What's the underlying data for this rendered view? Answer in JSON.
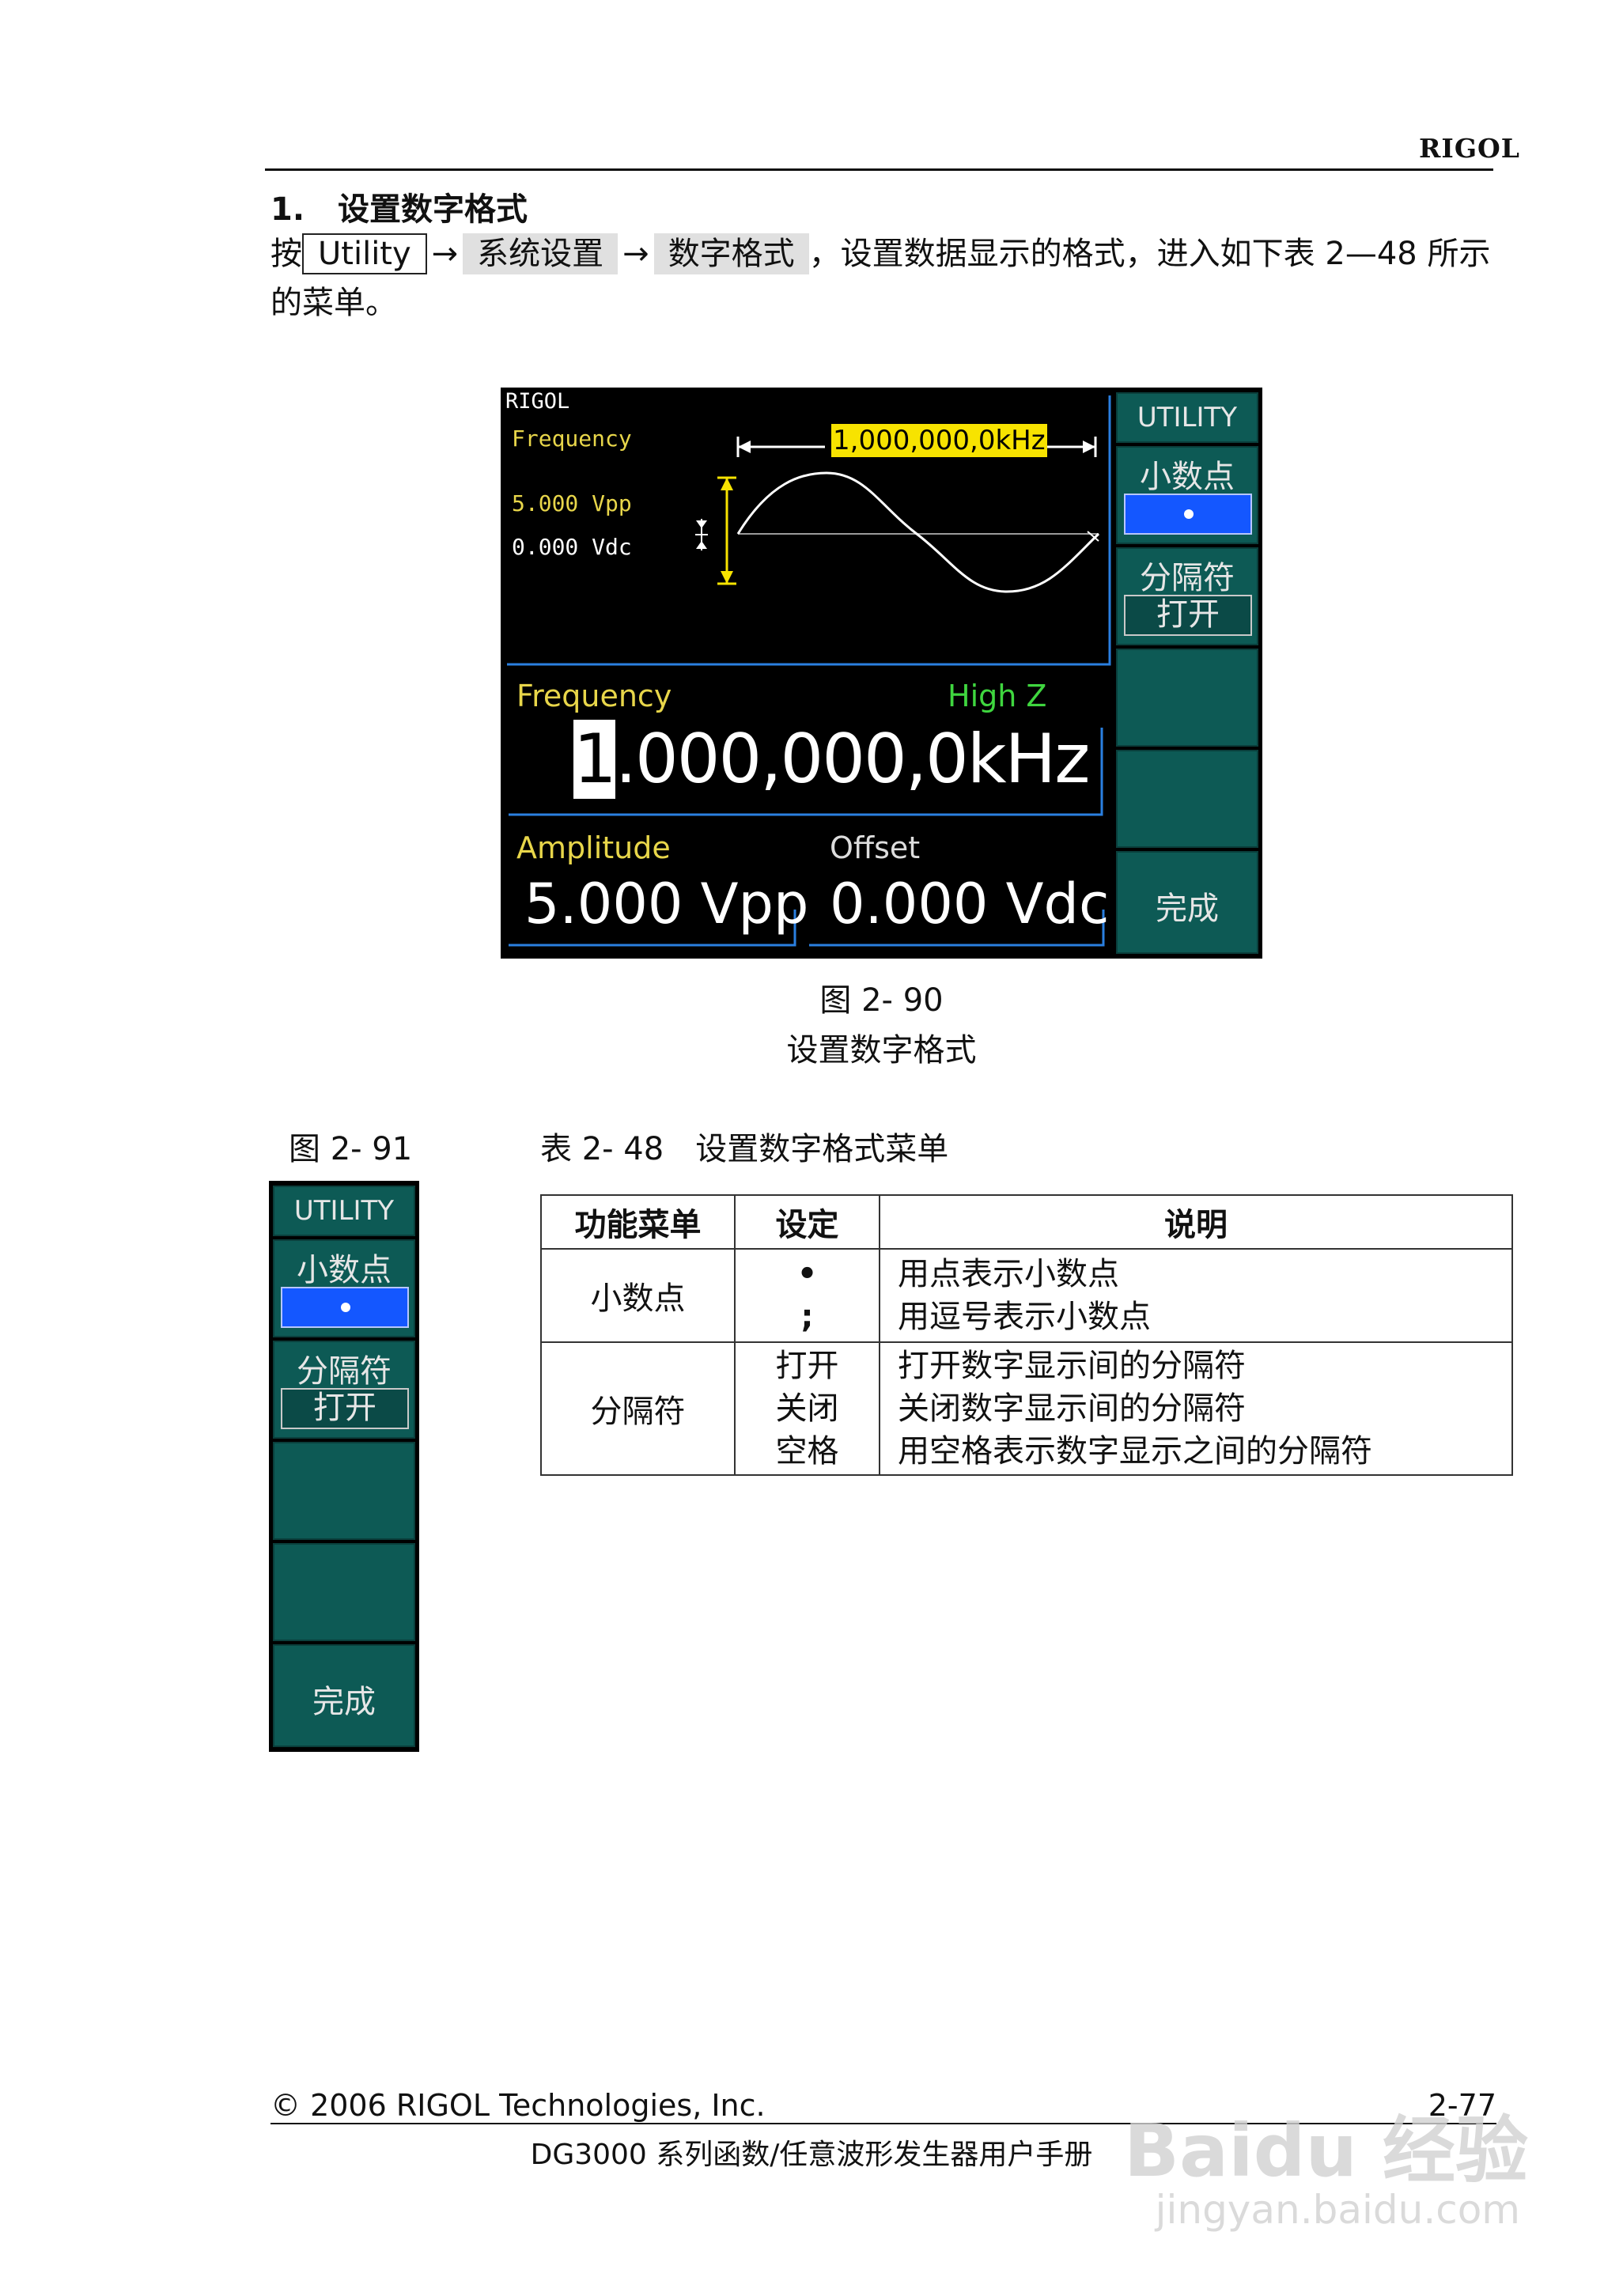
{
  "header": {
    "brand": "RIGOL"
  },
  "section": {
    "number": "1.",
    "title": "设置数字格式"
  },
  "instruction": {
    "prefix": "按",
    "key_utility": "Utility",
    "arrow": "→",
    "softkey_system": "系统设置",
    "softkey_format": "数字格式",
    "suffix": "，设置数据显示的格式，进入如下表 2—48 所示的菜单。"
  },
  "screen": {
    "brand": "RIGOL",
    "freq_label_small": "Frequency",
    "amp_small": "5.000 Vpp",
    "offset_small": "0.000 Vdc",
    "freq_badge_first": "1",
    "freq_badge": ",000,000,0kHz",
    "freq_label": "Frequency",
    "impedance": "High Z",
    "freq_cursor_digit": "1",
    "freq_value": ".000,000,0kHz",
    "amp_label": "Amplitude",
    "offset_label": "Offset",
    "amp_value": "5.000 Vpp",
    "offset_value": "0.000 Vdc",
    "menu": {
      "title": "UTILITY",
      "decimal_label": "小数点",
      "separator_label": "分隔符",
      "separator_value": "打开",
      "done_label": "完成"
    }
  },
  "fig90": {
    "number": "图 2- 90",
    "caption": "设置数字格式"
  },
  "fig91": {
    "number": "图 2- 91"
  },
  "table_caption": "表 2- 48　设置数字格式菜单",
  "table": {
    "headers": [
      "功能菜单",
      "设定",
      "说明"
    ],
    "rows": [
      {
        "menu": "小数点",
        "settings": [
          "•",
          ";"
        ],
        "desc": [
          "用点表示小数点",
          "用逗号表示小数点"
        ]
      },
      {
        "menu": "分隔符",
        "settings": [
          "打开",
          "关闭",
          "空格"
        ],
        "desc": [
          "打开数字显示间的分隔符",
          "关闭数字显示间的分隔符",
          "用空格表示数字显示之间的分隔符"
        ]
      }
    ]
  },
  "footer": {
    "copyright": "© 2006 RIGOL Technologies, Inc.",
    "page": "2-77",
    "manual": "DG3000 系列函数/任意波形发生器用户手册"
  },
  "watermark": {
    "main": "Baidu 经验",
    "sub": "jingyan.baidu.com"
  }
}
